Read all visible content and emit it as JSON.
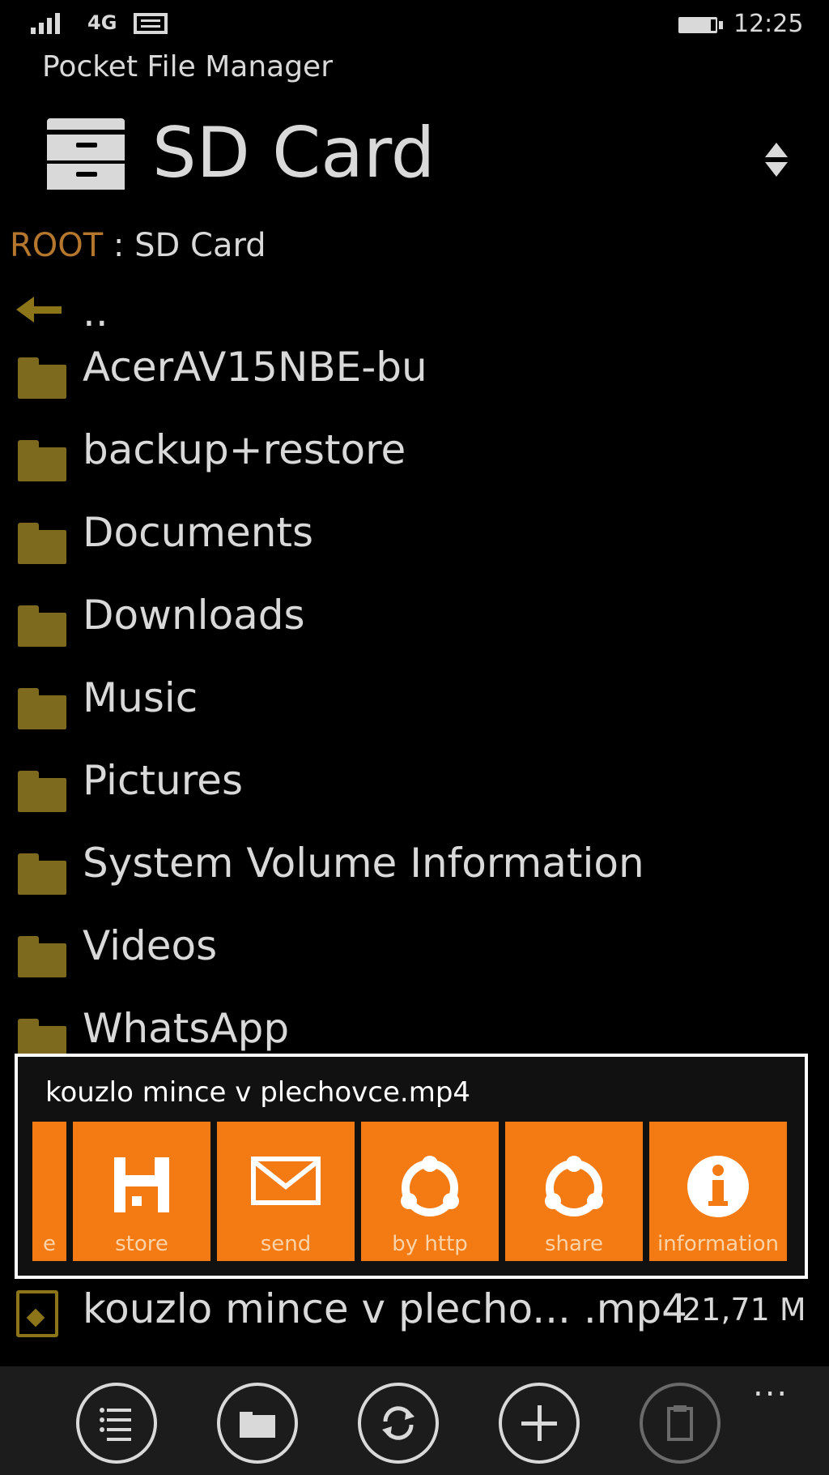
{
  "status_bar": {
    "network": "4G",
    "time": "12:25",
    "icons": [
      "signal-icon",
      "message-icon",
      "battery-icon"
    ]
  },
  "app": {
    "title": "Pocket File Manager"
  },
  "header": {
    "location": "SD Card",
    "icons": [
      "drawer-icon",
      "sort-icon"
    ]
  },
  "breadcrumb": {
    "root": "ROOT",
    "separator": " : ",
    "current": "SD Card"
  },
  "list": {
    "parent": "..",
    "folders": [
      "AcerAV15NBE-bu",
      "backup+restore",
      "Documents",
      "Downloads",
      "Music",
      "Pictures",
      "System Volume Information",
      "Videos",
      "WhatsApp"
    ]
  },
  "context_menu": {
    "title": "kouzlo mince v plechovce.mp4",
    "actions": [
      {
        "label": "e",
        "icon": ""
      },
      {
        "label": "store",
        "icon": "floppy-disk-icon"
      },
      {
        "label": "send",
        "icon": "envelope-icon"
      },
      {
        "label": "by http",
        "icon": "sync-circle-icon"
      },
      {
        "label": "share",
        "icon": "share-circle-icon"
      },
      {
        "label": "information",
        "icon": "info-icon"
      }
    ]
  },
  "file": {
    "name": "kouzlo mince v plecho... .mp4",
    "size": "21,71 M"
  },
  "app_bar": {
    "buttons": [
      {
        "icon": "list-icon",
        "enabled": true
      },
      {
        "icon": "folder-icon",
        "enabled": true
      },
      {
        "icon": "refresh-icon",
        "enabled": true
      },
      {
        "icon": "add-icon",
        "enabled": true
      },
      {
        "icon": "clipboard-icon",
        "enabled": false
      }
    ],
    "more": "..."
  },
  "colors": {
    "accent": "#f47a14",
    "folder": "#7e6a1e",
    "breadcrumb_root": "#b5762d",
    "text": "#d9d9d9"
  }
}
